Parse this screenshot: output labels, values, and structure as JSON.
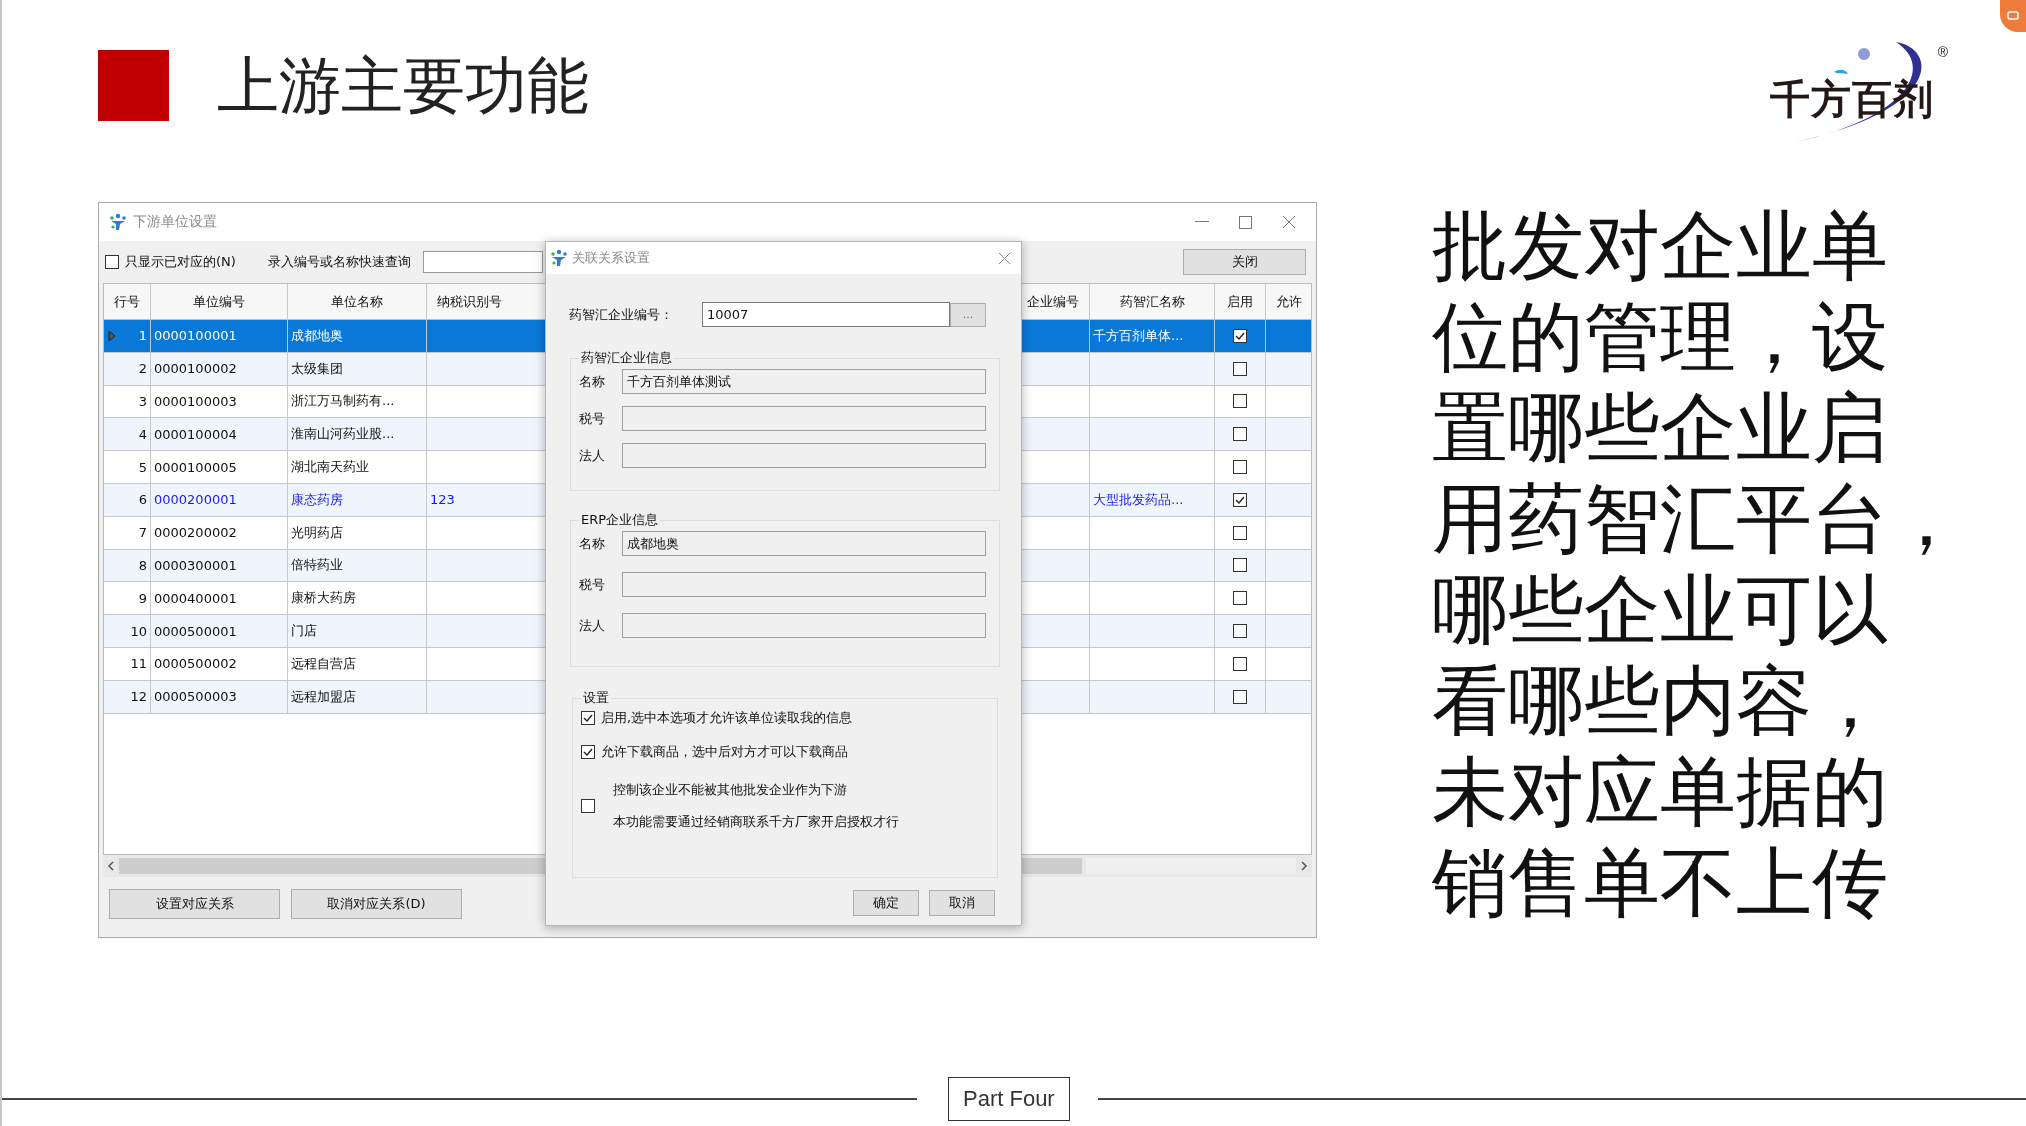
{
  "slide": {
    "title": "上游主要功能",
    "logo": {
      "text": "千方百剂",
      "mark": "®"
    },
    "description": [
      "批发对企业单",
      "位的管理，设",
      "置哪些企业启",
      "用药智汇平台，",
      "哪些企业可以",
      "看哪些内容，",
      "未对应单据的",
      "销售单不上传"
    ],
    "footer": "Part Four"
  },
  "window": {
    "title": "下游单位设置",
    "filter": {
      "label": "只显示已对应的(N)",
      "checked": false
    },
    "search_label": "录入编号或名称快速查询",
    "close_button": "关闭",
    "columns": [
      "行号",
      "单位编号",
      "单位名称",
      "纳税识别号",
      "企业编号",
      "药智汇名称",
      "启用",
      "允许"
    ],
    "rows": [
      {
        "no": "1",
        "code": "0000100001",
        "name": "成都地奥",
        "yzh_name": "千方百剂单体...",
        "enabled": true,
        "selected": true,
        "mapped": true
      },
      {
        "no": "2",
        "code": "0000100002",
        "name": "太级集团",
        "enabled": false,
        "selected": false,
        "mapped": false
      },
      {
        "no": "3",
        "code": "0000100003",
        "name": "浙江万马制药有...",
        "enabled": false,
        "selected": false,
        "mapped": false
      },
      {
        "no": "4",
        "code": "0000100004",
        "name": "淮南山河药业股...",
        "enabled": false,
        "selected": false,
        "mapped": false
      },
      {
        "no": "5",
        "code": "0000100005",
        "name": "湖北南天药业",
        "enabled": false,
        "selected": false,
        "mapped": false
      },
      {
        "no": "6",
        "code": "0000200001",
        "name": "康态药房",
        "tax_id": "123",
        "yzh_name": "大型批发药品...",
        "enabled": true,
        "selected": false,
        "mapped": true
      },
      {
        "no": "7",
        "code": "0000200002",
        "name": "光明药店",
        "enabled": false,
        "selected": false,
        "mapped": false
      },
      {
        "no": "8",
        "code": "0000300001",
        "name": "倍特药业",
        "enabled": false,
        "selected": false,
        "mapped": false
      },
      {
        "no": "9",
        "code": "0000400001",
        "name": "康桥大药房",
        "enabled": false,
        "selected": false,
        "mapped": false
      },
      {
        "no": "10",
        "code": "0000500001",
        "name": "门店",
        "enabled": false,
        "selected": false,
        "mapped": false
      },
      {
        "no": "11",
        "code": "0000500002",
        "name": "远程自营店",
        "enabled": false,
        "selected": false,
        "mapped": false
      },
      {
        "no": "12",
        "code": "0000500003",
        "name": "远程加盟店",
        "enabled": false,
        "selected": false,
        "mapped": false
      }
    ],
    "buttons": [
      "设置对应关系",
      "取消对应关系(D)"
    ]
  },
  "dialog": {
    "title": "关联关系设置",
    "id_label": "药智汇企业编号：",
    "id_value": "10007",
    "browse_button": "...",
    "groups": [
      {
        "title": "药智汇企业信息",
        "fields": [
          {
            "label": "名称",
            "value": "千方百剂单体测试"
          },
          {
            "label": "税号"
          },
          {
            "label": "法人"
          }
        ]
      },
      {
        "title": "ERP企业信息",
        "fields": [
          {
            "label": "名称",
            "value": "成都地奥"
          },
          {
            "label": "税号"
          },
          {
            "label": "法人"
          }
        ]
      }
    ],
    "settings": {
      "title": "设置",
      "options": [
        {
          "lines": [
            "启用,选中本选项才允许该单位读取我的信息"
          ],
          "checked": true
        },
        {
          "lines": [
            "允许下载商品，选中后对方才可以下载商品"
          ],
          "checked": true
        },
        {
          "lines": [
            "控制该企业不能被其他批发企业作为下游",
            "本功能需要通过经销商联系千方厂家开启授权才行"
          ],
          "checked": false
        }
      ]
    },
    "buttons": [
      "确定",
      "取消"
    ]
  }
}
